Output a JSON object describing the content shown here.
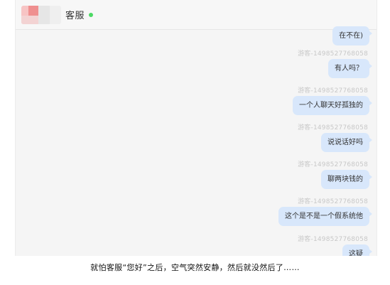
{
  "header": {
    "title": "客服",
    "status_color": "#4cd964"
  },
  "messages": [
    {
      "sender": "",
      "text": "在不在)"
    },
    {
      "sender": "游客-1498527768058",
      "text": "有人吗？"
    },
    {
      "sender": "游客-1498527768058",
      "text": "一个人聊天好孤独的"
    },
    {
      "sender": "游客-1498527768058",
      "text": "说说话好吗"
    },
    {
      "sender": "游客-1498527768058",
      "text": "聊两块钱的"
    },
    {
      "sender": "游客-1498527768058",
      "text": "这个是不是一个假系统他"
    },
    {
      "sender": "游客-1498527768058",
      "text": "这疑"
    }
  ],
  "caption": "就怕客服“您好”之后，空气突然安静，然后就没然后了……",
  "colors": {
    "bubble": "#d8e7fb",
    "background": "#f5f5f5"
  }
}
